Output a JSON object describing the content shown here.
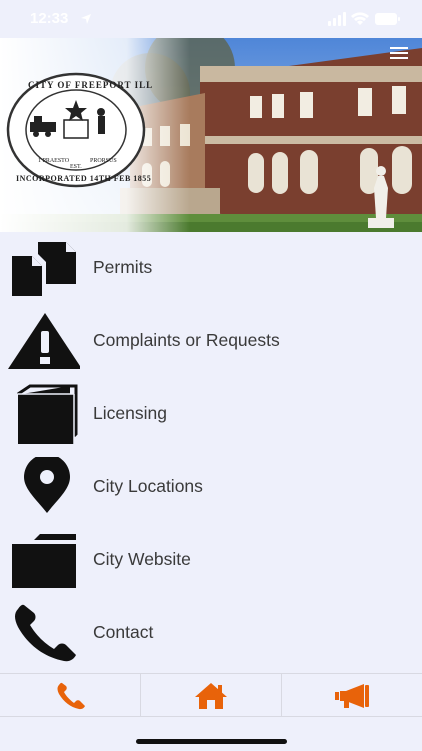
{
  "status_bar": {
    "time": "12:33"
  },
  "hero": {
    "seal_top_text": "CITY OF FREEPORT ILL",
    "seal_bottom_text": "INCORPORATED 14TH FEB 1855",
    "seal_scroll_left": "1 PRAESTO",
    "seal_scroll_right": "PRORSUS",
    "seal_est_text": "EST."
  },
  "menu": {
    "items": [
      {
        "label": "Permits",
        "icon": "documents-icon"
      },
      {
        "label": "Complaints or Requests",
        "icon": "warning-icon"
      },
      {
        "label": "Licensing",
        "icon": "license-icon"
      },
      {
        "label": "City Locations",
        "icon": "map-pin-icon"
      },
      {
        "label": "City Website",
        "icon": "folder-icon"
      },
      {
        "label": "Contact",
        "icon": "phone-icon"
      }
    ]
  },
  "tab_bar": {
    "tabs": [
      {
        "icon": "phone-icon"
      },
      {
        "icon": "home-icon"
      },
      {
        "icon": "megaphone-icon"
      }
    ]
  },
  "colors": {
    "accent": "#e8630a",
    "background": "#eef0fb",
    "text": "#3a3a3a"
  }
}
